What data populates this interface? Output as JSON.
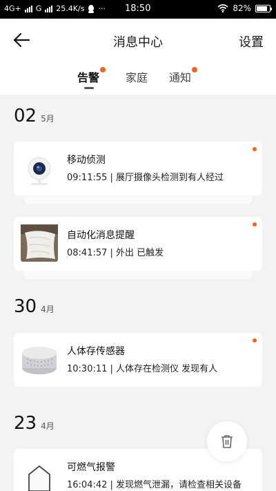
{
  "status_bar": {
    "network_1": "4G+",
    "network_2": "G",
    "speed": "25.4K/s",
    "more": "···",
    "time": "18:50",
    "battery_percent": "82%",
    "battery_level": 0.82
  },
  "header": {
    "title": "消息中心",
    "settings_label": "设置"
  },
  "tabs": [
    {
      "label": "告警",
      "active": true,
      "badge": true
    },
    {
      "label": "家庭",
      "active": false,
      "badge": false
    },
    {
      "label": "通知",
      "active": false,
      "badge": true
    }
  ],
  "groups": [
    {
      "day": "02",
      "month": "5月",
      "items": [
        {
          "title": "移动侦测",
          "desc": "09:11:55 | 展厅摄像头检测到有人经过",
          "icon": "camera-icon",
          "unread": true
        },
        {
          "title": "自动化消息提醒",
          "desc": "08:41:57 | 外出 已触发",
          "icon": "pillow-photo",
          "unread": true
        }
      ]
    },
    {
      "day": "30",
      "month": "4月",
      "items": [
        {
          "title": "人体存传感器",
          "desc": "10:30:11 | 人体存在检测仪 发现有人",
          "icon": "sensor-icon",
          "unread": true
        }
      ]
    },
    {
      "day": "23",
      "month": "4月",
      "items": [
        {
          "title": "可燃气报警",
          "desc": "16:04:42 | 发现燃气泄漏，请检查相关设备",
          "icon": "house-icon",
          "unread": false
        }
      ]
    }
  ],
  "colors": {
    "accent": "#f0641e",
    "background": "#f3f3f3",
    "card": "#ffffff"
  }
}
